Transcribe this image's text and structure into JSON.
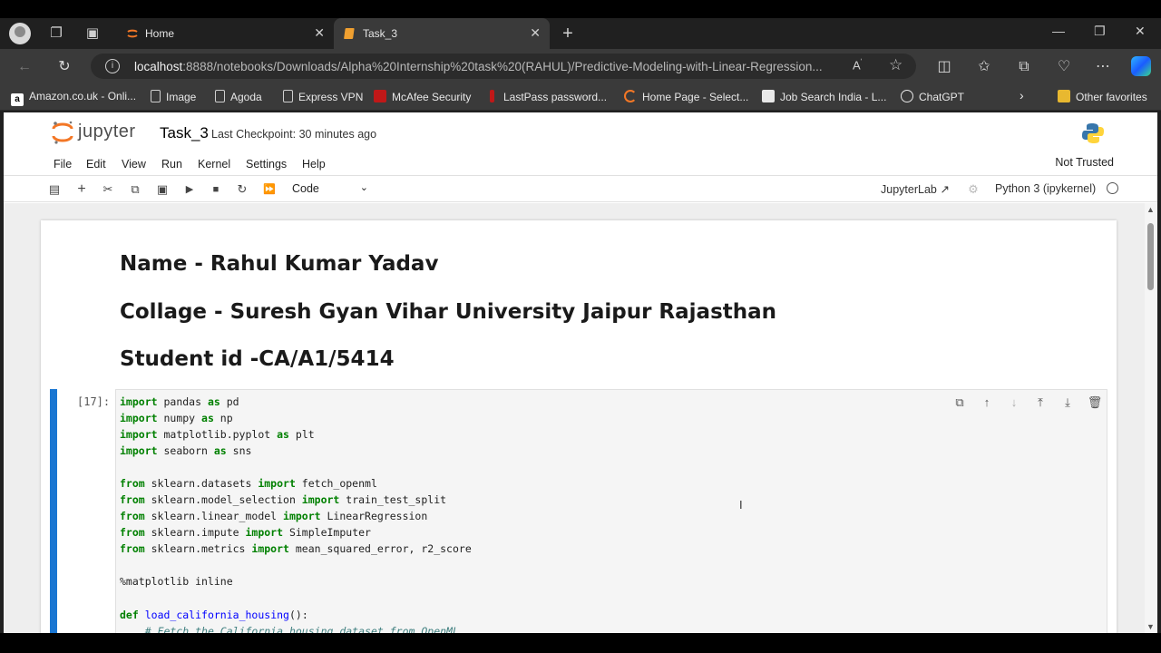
{
  "browser": {
    "tabs": [
      {
        "label": "Home",
        "active": false
      },
      {
        "label": "Task_3",
        "active": true
      }
    ],
    "url": {
      "host": "localhost",
      "rest": ":8888/notebooks/Downloads/Alpha%20Internship%20task%20(RAHUL)/Predictive-Modeling-with-Linear-Regression..."
    },
    "favorites": [
      "Amazon.co.uk - Onli...",
      "Image",
      "Agoda",
      "Express VPN",
      "McAfee Security",
      "LastPass password...",
      "Home Page - Select...",
      "Job Search India - L...",
      "ChatGPT"
    ],
    "other_favorites": "Other favorites"
  },
  "jupyter": {
    "logo": "jupyter",
    "notebook_title": "Task_3",
    "checkpoint": "Last Checkpoint: 30 minutes ago",
    "menu": [
      "File",
      "Edit",
      "View",
      "Run",
      "Kernel",
      "Settings",
      "Help"
    ],
    "trust": "Not Trusted",
    "cell_type": "Code",
    "jupyterlab_link": "JupyterLab",
    "kernel": "Python 3 (ipykernel)"
  },
  "notebook": {
    "markdown": [
      "Name - Rahul Kumar Yadav",
      "Collage - Suresh Gyan Vihar University Jaipur Rajasthan",
      "Student id -CA/A1/5414"
    ],
    "code_cell": {
      "prompt": "[17]:"
    }
  },
  "colors": {
    "accent": "#1976d2",
    "jupyter_orange": "#f37726"
  }
}
